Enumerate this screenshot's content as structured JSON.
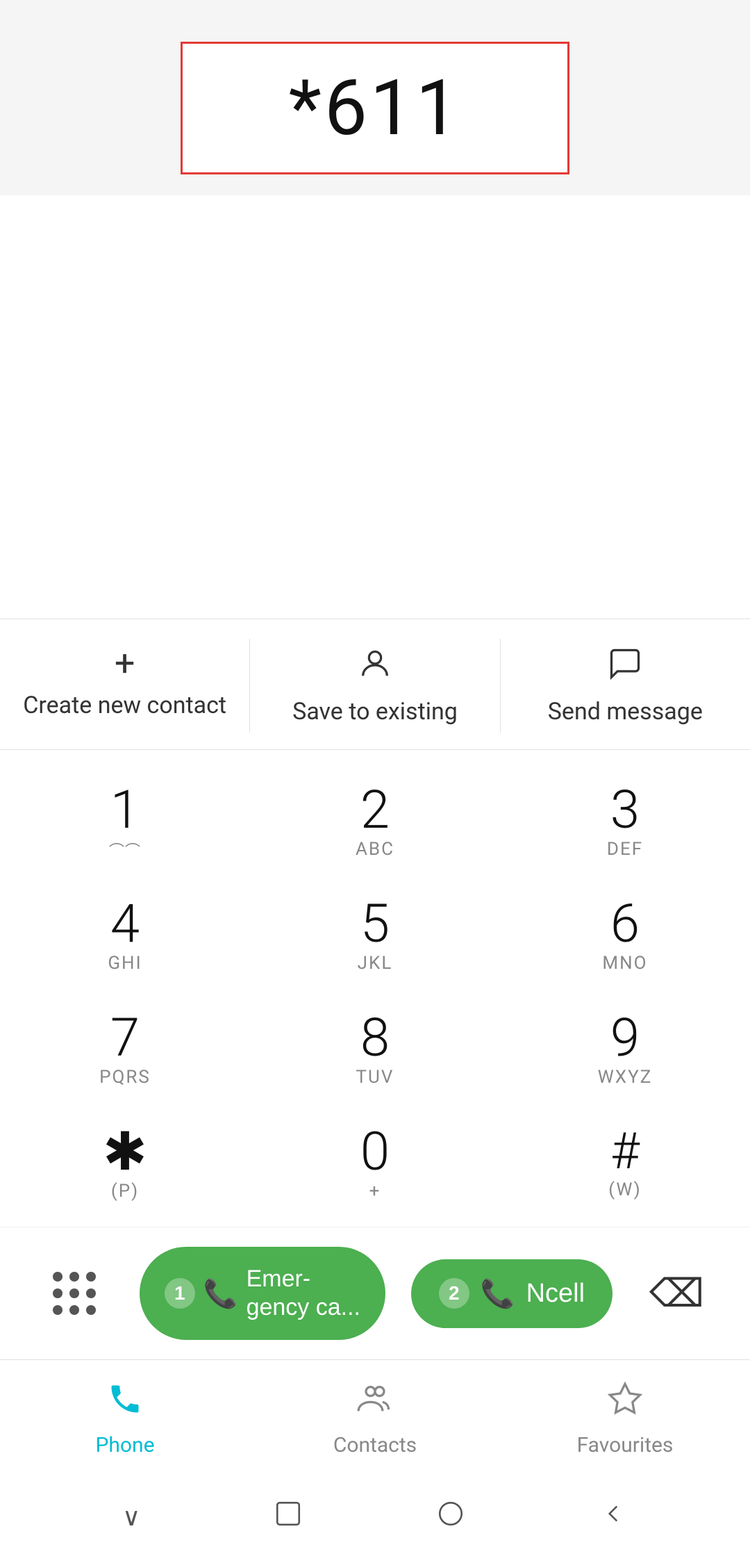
{
  "dialer": {
    "phone_number": "*611",
    "input_border_color": "#e53935"
  },
  "actions": [
    {
      "id": "create-contact",
      "label": "Create new contact",
      "icon": "plus"
    },
    {
      "id": "save-existing",
      "label": "Save to existing",
      "icon": "person"
    },
    {
      "id": "send-message",
      "label": "Send message",
      "icon": "chat"
    }
  ],
  "dialpad": {
    "keys": [
      {
        "number": "1",
        "letters": "◌◌"
      },
      {
        "number": "2",
        "letters": "ABC"
      },
      {
        "number": "3",
        "letters": "DEF"
      },
      {
        "number": "4",
        "letters": "GHI"
      },
      {
        "number": "5",
        "letters": "JKL"
      },
      {
        "number": "6",
        "letters": "MNO"
      },
      {
        "number": "7",
        "letters": "PQRS"
      },
      {
        "number": "8",
        "letters": "TUV"
      },
      {
        "number": "9",
        "letters": "WXYZ"
      },
      {
        "number": "*",
        "letters": "(P)"
      },
      {
        "number": "0",
        "letters": "+"
      },
      {
        "number": "#",
        "letters": "(W)"
      }
    ]
  },
  "call_buttons": [
    {
      "id": "emergency",
      "label": "Emer-gency ca...",
      "sim": "1"
    },
    {
      "id": "ncell",
      "label": "Ncell",
      "sim": "2"
    }
  ],
  "nav": {
    "items": [
      {
        "id": "phone",
        "label": "Phone",
        "active": true
      },
      {
        "id": "contacts",
        "label": "Contacts",
        "active": false
      },
      {
        "id": "favourites",
        "label": "Favourites",
        "active": false
      }
    ]
  },
  "colors": {
    "active_nav": "#00bcd4",
    "call_green": "#4caf50",
    "border_red": "#e53935"
  }
}
